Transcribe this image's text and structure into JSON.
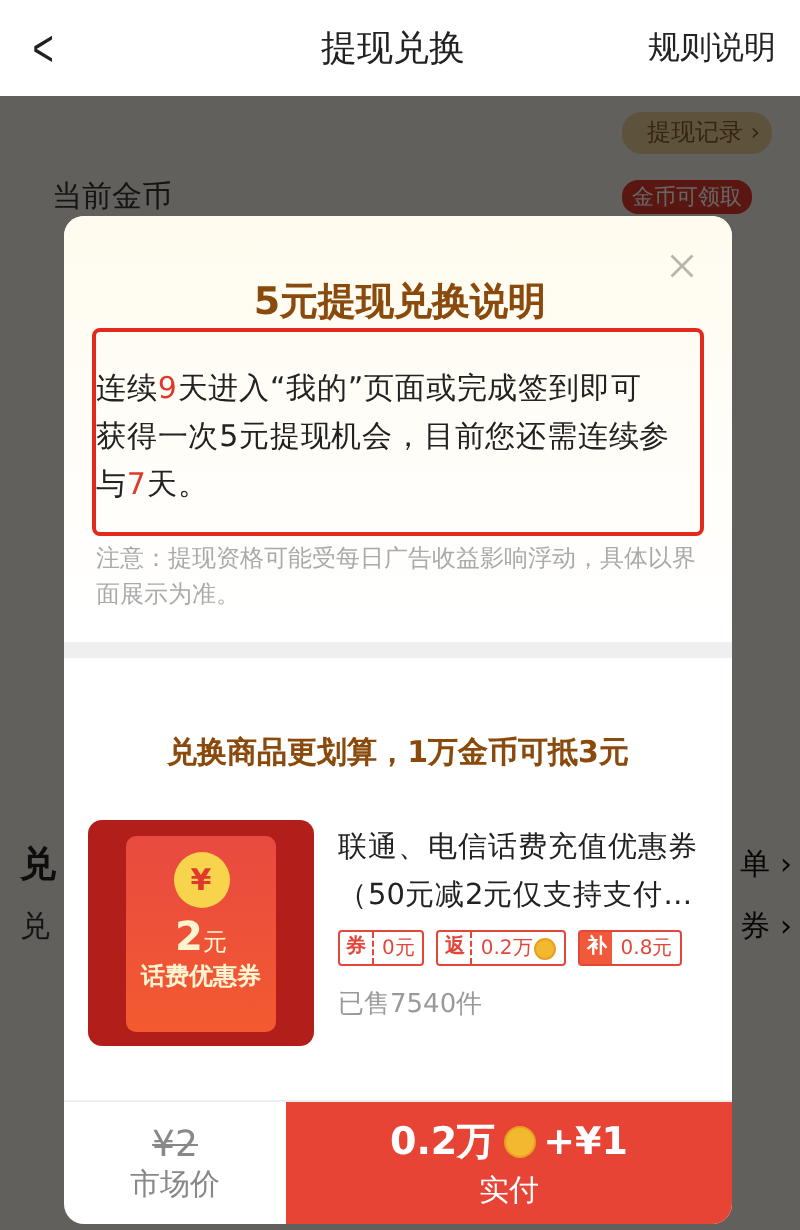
{
  "header": {
    "back": "<",
    "title": "提现兑换",
    "action": "规则说明"
  },
  "background": {
    "record_link": "提现记录 ›",
    "coins_label": "当前金币",
    "coins_badge": "金币可领取",
    "section_1": "兑",
    "section_1_link": "单 ›",
    "section_2": "兑",
    "section_2_link": "券 ›"
  },
  "dialog": {
    "title": "5元提现兑换说明",
    "description": [
      {
        "text": "连续",
        "highlight": false
      },
      {
        "text": "9",
        "highlight": true
      },
      {
        "text": "天进入“我的”页面或完成签到即可获得一次5元提现机会，目前您还需连续参与",
        "highlight": false
      },
      {
        "text": "7",
        "highlight": true
      },
      {
        "text": "天。",
        "highlight": false
      }
    ],
    "note": "注意：提现资格可能受每日广告收益影响浮动，具体以界面展示为准。",
    "promo": "兑换商品更划算，1万金币可抵3元",
    "product": {
      "coupon_symbol": "¥",
      "coupon_amount": "2",
      "coupon_unit": "元",
      "coupon_name": "话费优惠券",
      "name": "联通、电信话费充值优惠券（50元减2元仅支持支付…",
      "tags": [
        {
          "kind": "outline",
          "label": "券",
          "value": "0元",
          "coin": false
        },
        {
          "kind": "outline",
          "label": "返",
          "value": "0.2万",
          "coin": true
        },
        {
          "kind": "solid",
          "label": "补",
          "value": "0.8元",
          "coin": false
        }
      ],
      "sold": "已售7540件"
    },
    "market_price": "¥2",
    "market_label": "市场价",
    "pay_coins": "0.2万",
    "pay_cash": "+¥1",
    "pay_label": "实付"
  }
}
